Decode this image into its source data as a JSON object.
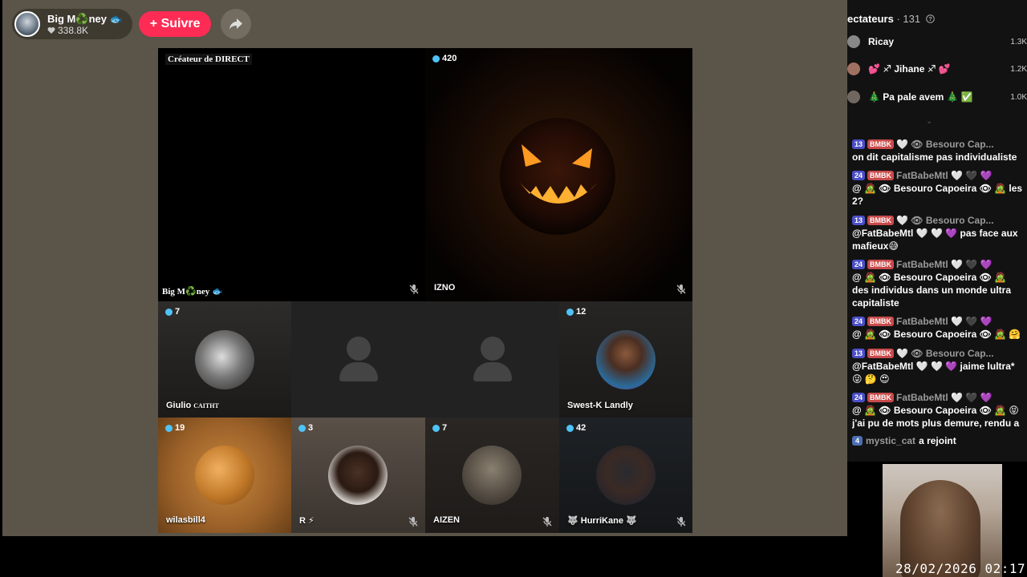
{
  "header": {
    "host_name": "Big M♻️ney 🐟",
    "likes": "338.8K",
    "follow_label": "+ Suivre"
  },
  "grid": {
    "creator_tile": {
      "role_label": "Créateur de DIRECT",
      "name": "Big M♻️ney 🐟"
    },
    "guest_tiles": [
      {
        "name": "IZNO",
        "count": "420",
        "image": "jack-o-lantern"
      },
      {
        "name": "Giulio",
        "tag": "CAITHT",
        "count": "7"
      },
      {
        "name": "",
        "count": ""
      },
      {
        "name": "",
        "count": ""
      },
      {
        "name": "Swest-K Landly",
        "count": "12"
      },
      {
        "name": "wilasbill4",
        "count": "19"
      },
      {
        "name": "R ⚡",
        "count": "3"
      },
      {
        "name": "AIZEN",
        "count": "7"
      },
      {
        "name": "🐺 HurriKane 🐺",
        "count": "42"
      }
    ]
  },
  "viewers": {
    "title": "ectateurs",
    "count": "· 131",
    "list": [
      {
        "name": "Ricay",
        "score": "1.3K"
      },
      {
        "name": "💕 ♐ Jihane ♐ 💕",
        "score": "1.2K"
      },
      {
        "name": "🎄 Pa pale avem 🎄 ✅",
        "score": "1.0K"
      }
    ]
  },
  "chat": [
    {
      "level": "13",
      "club": "BMBK",
      "user": "🤍 👁 Besouro Cap...",
      "text": "on dit capitalisme pas individualiste"
    },
    {
      "level": "24",
      "club": "BMBK",
      "user": "FatBabeMtl 🤍 🖤 💜",
      "text": "@ 🧟 👁 Besouro Capoeira 👁 🧟 les 2?"
    },
    {
      "level": "13",
      "club": "BMBK",
      "user": "🤍 👁 Besouro Cap...",
      "text": "@FatBabeMtl 🤍 🤍 💜 pas face aux mafieux😅"
    },
    {
      "level": "24",
      "club": "BMBK",
      "user": "FatBabeMtl 🤍 🖤 💜",
      "text": "@ 🧟 👁 Besouro Capoeira 👁 🧟 des individus dans un monde ultra capitaliste"
    },
    {
      "level": "24",
      "club": "BMBK",
      "user": "FatBabeMtl 🤍 🖤 💜",
      "text": "@ 🧟 👁 Besouro Capoeira 👁 🧟 🤗"
    },
    {
      "level": "13",
      "club": "BMBK",
      "user": "🤍 👁 Besouro Cap...",
      "text": "@FatBabeMtl 🤍 🤍 💜 jaime lultra* 😜 🤔 😍"
    },
    {
      "level": "24",
      "club": "BMBK",
      "user": "FatBabeMtl 🤍 🖤 💜",
      "text": "@ 🧟 👁 Besouro Capoeira 👁 🧟 😝 j'ai pu de mots plus demure, rendu a"
    }
  ],
  "join": {
    "level": "4",
    "user": "mystic_cat",
    "text": "a rejoint"
  },
  "timestamp": "28/02/2026 02:17",
  "colors": {
    "follow": "#fe2c55",
    "level_badge": "#4b4fc7",
    "club_badge": "#c94a4a",
    "count_dot": "#4fc3f7"
  },
  "icons": [
    "share-icon",
    "heart-icon",
    "mic-muted-icon",
    "help-icon",
    "chevron-down-icon",
    "person-placeholder-icon"
  ]
}
